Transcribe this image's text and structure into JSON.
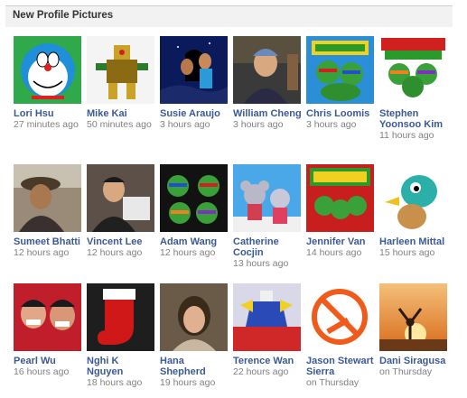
{
  "section": {
    "title": "New Profile Pictures"
  },
  "rows": [
    [
      {
        "name": "Lori Hsu",
        "time": "27 minutes ago",
        "icon": "doraemon",
        "bg": "#2fa94a"
      },
      {
        "name": "Mike Kai",
        "time": "50 minutes ago",
        "icon": "robot-figure",
        "bg": "#f4f4f4"
      },
      {
        "name": "Susie Araujo",
        "time": "3 hours ago",
        "icon": "aladdin-scene",
        "bg": "#0b1a5a"
      },
      {
        "name": "William Cheng",
        "time": "3 hours ago",
        "icon": "person-photo",
        "bg": "#3a3a3a"
      },
      {
        "name": "Chris Loomis",
        "time": "3 hours ago",
        "icon": "ninja-turtles",
        "bg": "#2a8fd6"
      },
      {
        "name": "Stephen Yoonsoo Kim",
        "time": "11 hours ago",
        "icon": "ninja-turtles",
        "bg": "#ffffff"
      }
    ],
    [
      {
        "name": "Sumeet Bhatti",
        "time": "12 hours ago",
        "icon": "person-photo",
        "bg": "#9a8a78"
      },
      {
        "name": "Vincent Lee",
        "time": "12 hours ago",
        "icon": "person-photo",
        "bg": "#5c5048"
      },
      {
        "name": "Adam Wang",
        "time": "12 hours ago",
        "icon": "ninja-turtles",
        "bg": "#121212"
      },
      {
        "name": "Catherine Cocjin",
        "time": "13 hours ago",
        "icon": "cartoon-koalas",
        "bg": "#4aa8e8"
      },
      {
        "name": "Jennifer Van",
        "time": "14 hours ago",
        "icon": "ninja-turtles",
        "bg": "#c81e1e"
      },
      {
        "name": "Harleen Mittal",
        "time": "15 hours ago",
        "icon": "cartoon-bird",
        "bg": "#ffffff"
      }
    ],
    [
      {
        "name": "Pearl Wu",
        "time": "16 hours ago",
        "icon": "person-photo",
        "bg": "#c01e2a"
      },
      {
        "name": "Nghi K Nguyen",
        "time": "18 hours ago",
        "icon": "christmas-stocking",
        "bg": "#1e1e1e"
      },
      {
        "name": "Hana Shepherd",
        "time": "19 hours ago",
        "icon": "person-photo",
        "bg": "#6a5a48"
      },
      {
        "name": "Terence Wan",
        "time": "22 hours ago",
        "icon": "robot-figure",
        "bg": "#d8d8e8"
      },
      {
        "name": "Jason Stewart Sierra",
        "time": "on Thursday",
        "icon": "no-smoking-sign",
        "bg": "#ffffff"
      },
      {
        "name": "Dani Siragusa",
        "time": "on Thursday",
        "icon": "sunset-silhouette",
        "bg": "#e8902a"
      }
    ]
  ]
}
